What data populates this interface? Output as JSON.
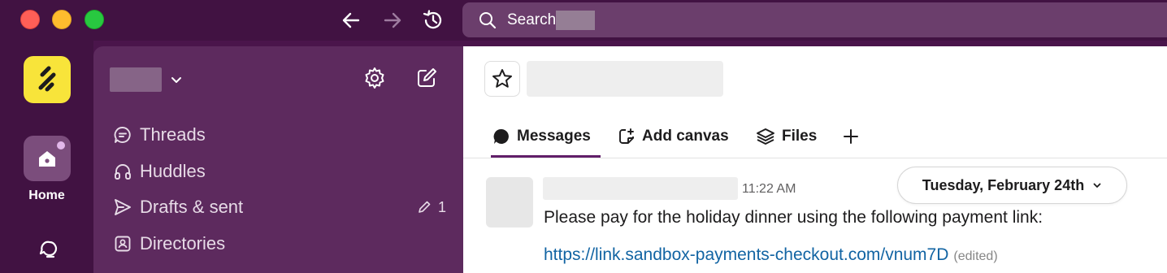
{
  "titlebar": {
    "search_label": "Search"
  },
  "rail": {
    "home_label": "Home"
  },
  "sidebar": {
    "items": [
      {
        "label": "Threads",
        "icon": "threads-icon"
      },
      {
        "label": "Huddles",
        "icon": "headphones-icon"
      },
      {
        "label": "Drafts & sent",
        "icon": "send-icon",
        "badge": "1"
      },
      {
        "label": "Directories",
        "icon": "directory-icon"
      }
    ]
  },
  "main": {
    "tabs": [
      {
        "label": "Messages",
        "icon": "messages-icon",
        "active": true
      },
      {
        "label": "Add canvas",
        "icon": "canvas-icon"
      },
      {
        "label": "Files",
        "icon": "files-icon"
      }
    ],
    "date_divider": "Tuesday, February 24th",
    "message": {
      "time": "11:22 AM",
      "text": "Please pay for the holiday dinner using the following payment link:",
      "link": "https://link.sandbox-payments-checkout.com/vnum7D",
      "edited": "(edited)"
    }
  },
  "colors": {
    "titlebar_bg": "#411242",
    "sidebar_bg": "#5d2a5e",
    "accent": "#611f69",
    "link": "#1264a3",
    "workspace_logo": "#f8e43a"
  }
}
